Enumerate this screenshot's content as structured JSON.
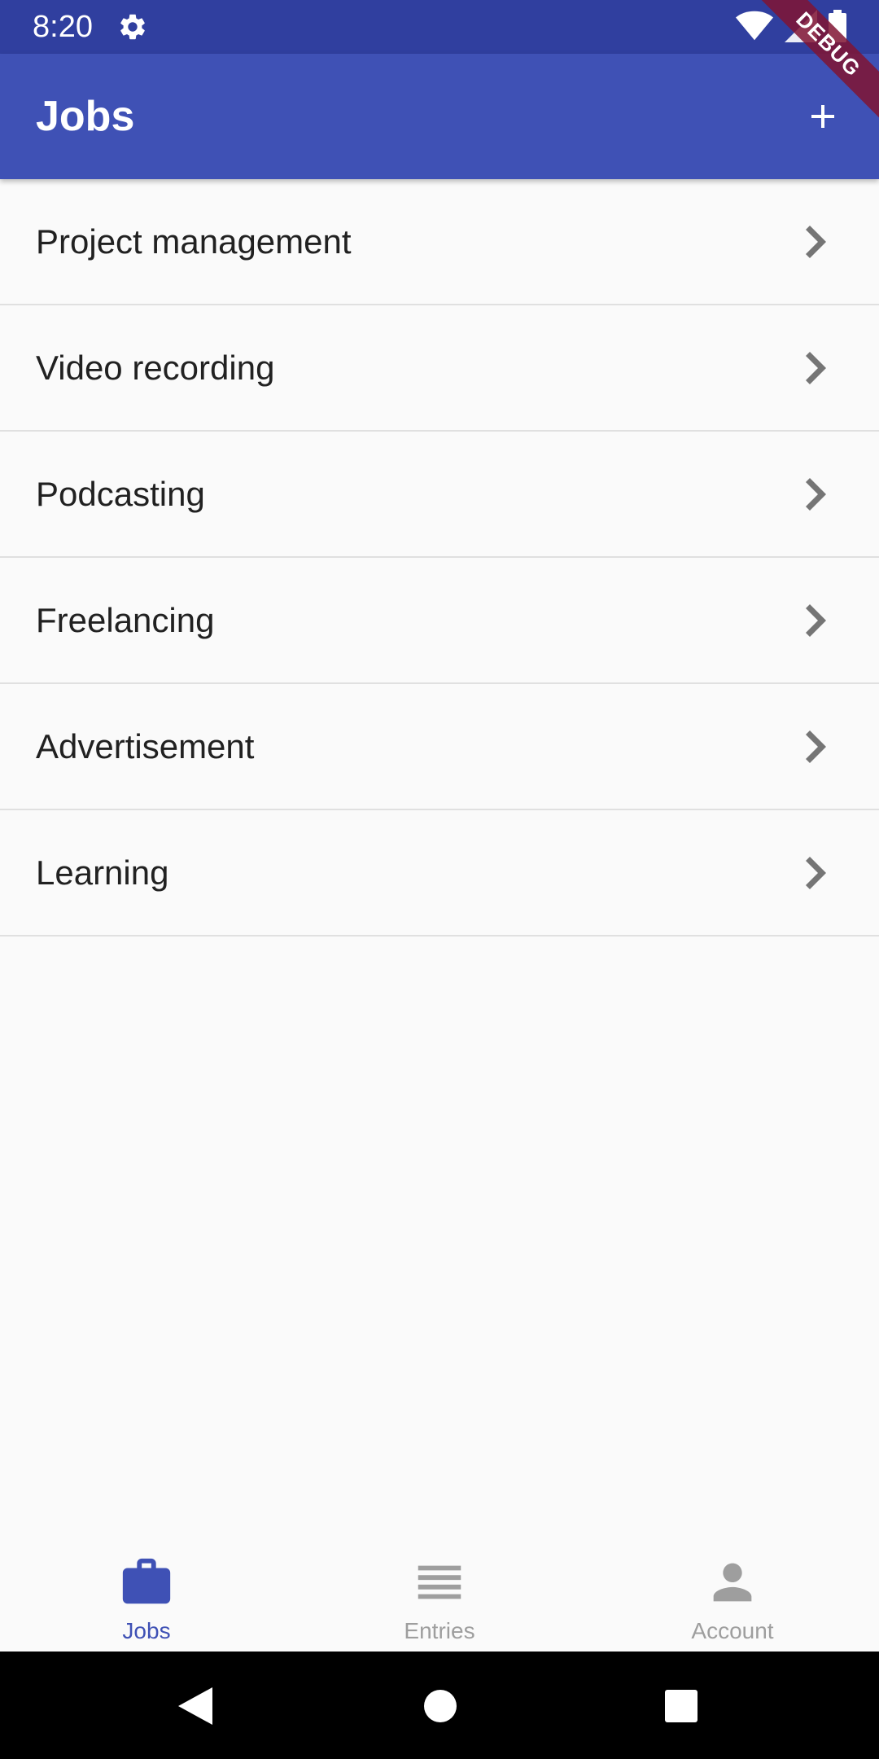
{
  "status_bar": {
    "time": "8:20",
    "icons": [
      "gear-icon",
      "wifi-icon",
      "signal-icon",
      "battery-icon"
    ]
  },
  "app_bar": {
    "title": "Jobs",
    "action_icon": "add-icon"
  },
  "debug_banner": {
    "label": "DEBUG"
  },
  "jobs": [
    {
      "label": "Project management"
    },
    {
      "label": "Video recording"
    },
    {
      "label": "Podcasting"
    },
    {
      "label": "Freelancing"
    },
    {
      "label": "Advertisement"
    },
    {
      "label": "Learning"
    }
  ],
  "bottom_nav": {
    "tabs": [
      {
        "label": "Jobs",
        "icon": "briefcase-icon",
        "selected": true
      },
      {
        "label": "Entries",
        "icon": "list-icon",
        "selected": false
      },
      {
        "label": "Account",
        "icon": "person-icon",
        "selected": false
      }
    ]
  },
  "system_nav": {
    "buttons": [
      "back-icon",
      "home-icon",
      "recents-icon"
    ]
  },
  "colors": {
    "primary": "#3f51b5",
    "primary_dark": "#303f9f",
    "selected_tab": "#3f51b5",
    "unselected_tab": "#9e9e9e",
    "divider": "#e0e0e0",
    "background": "#fafafa",
    "debug_ribbon": "#801432"
  }
}
